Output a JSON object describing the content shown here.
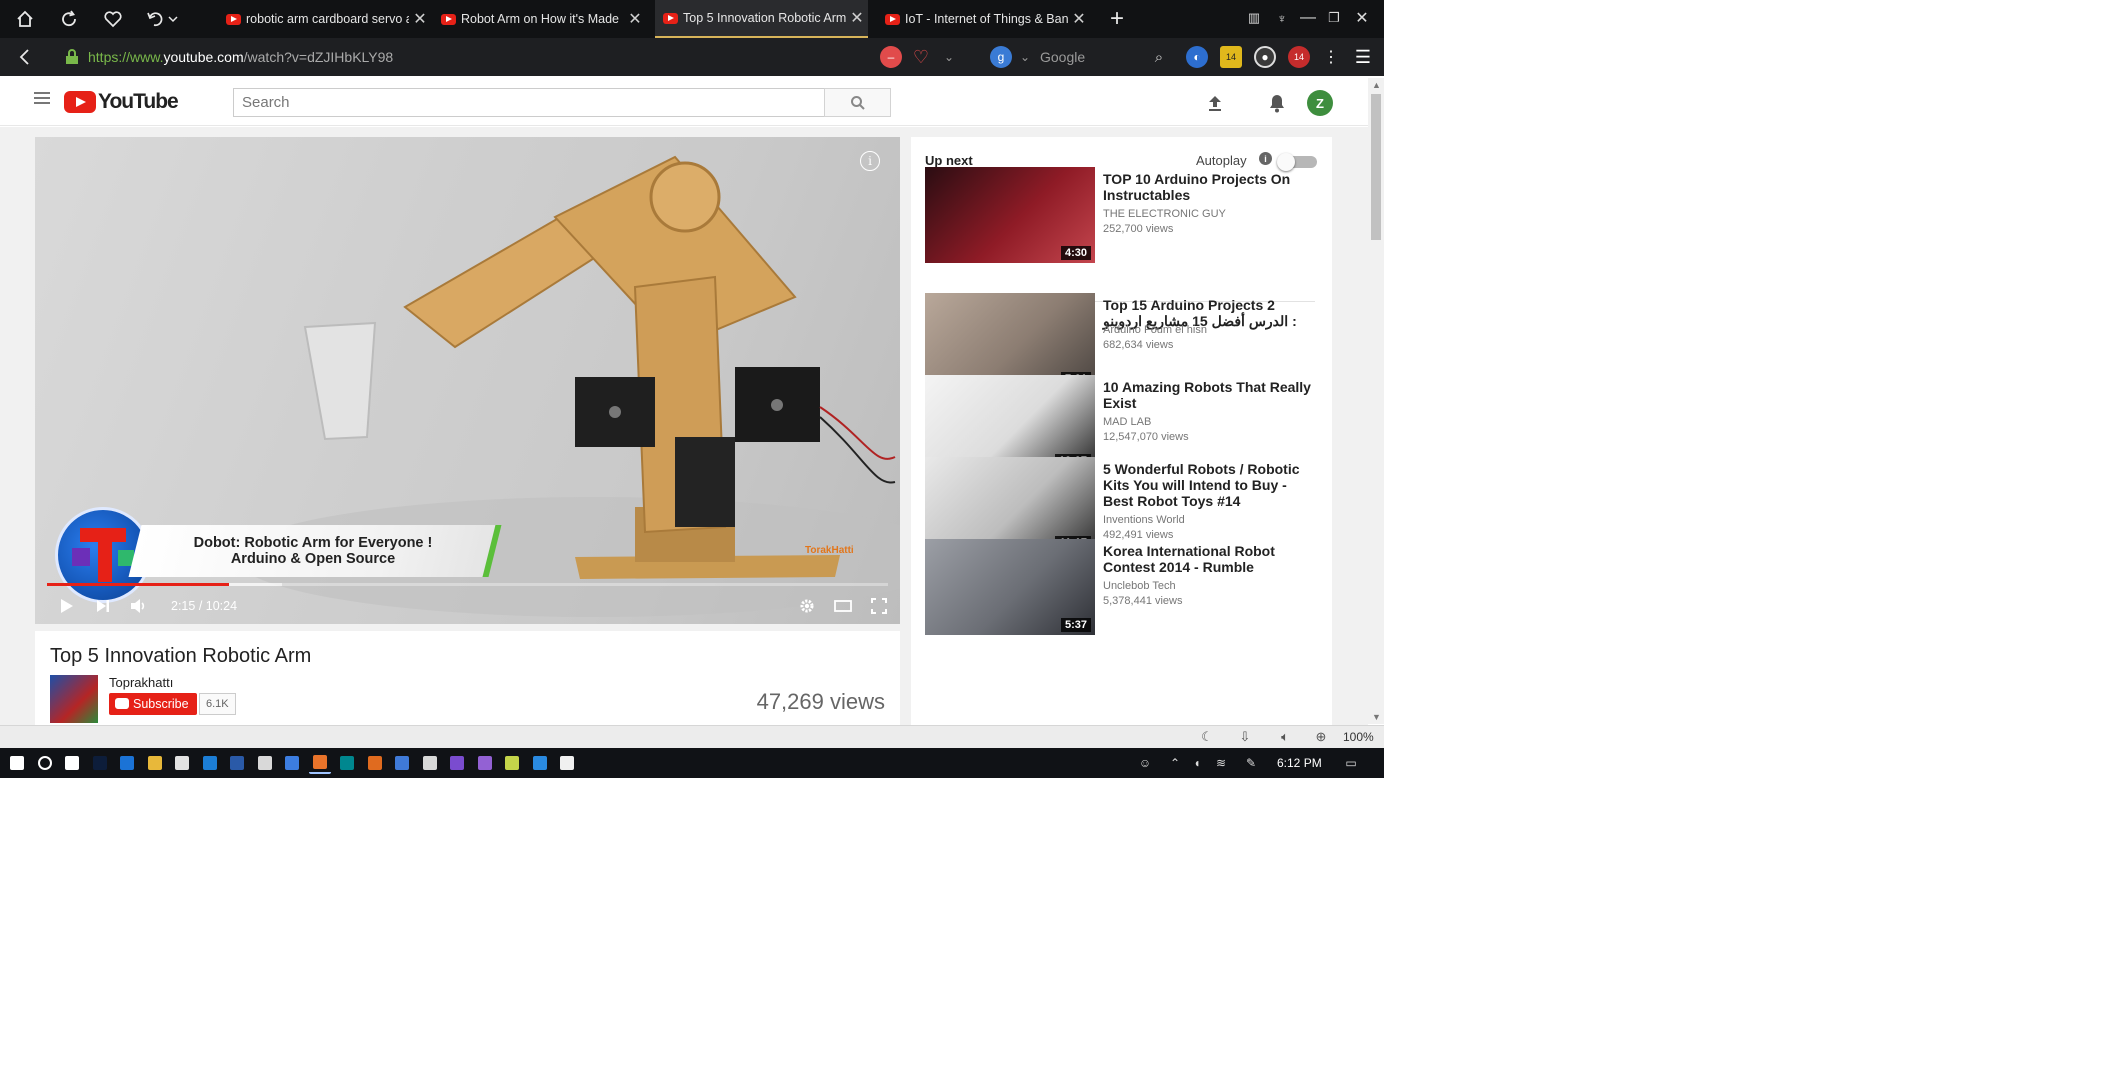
{
  "browser": {
    "tabs": [
      {
        "title": "robotic arm cardboard servo a",
        "active": false
      },
      {
        "title": "Robot Arm on How it's Made",
        "active": false
      },
      {
        "title": "Top 5 Innovation Robotic Arm",
        "active": true
      },
      {
        "title": "IoT - Internet of Things & Ban",
        "active": false
      }
    ],
    "url_scheme": "https://www.",
    "url_domain": "youtube.com",
    "url_path": "/watch?v=dZJIHbKLY98",
    "search_engine_placeholder": "Google",
    "addon_badges": {
      "badge_a": "14",
      "badge_b": "14"
    },
    "zoom_level": "100%"
  },
  "youtube": {
    "logo_text": "YouTube",
    "search_placeholder": "Search",
    "avatar_letter": "Z",
    "player": {
      "overlay_line1": "Dobot: Robotic Arm for Everyone !",
      "overlay_line2": "Arduino & Open Source",
      "watermark": "TorakHatti",
      "time_current": "2:15",
      "time_separator": " / ",
      "time_total": "10:24",
      "progress_fraction": 0.216,
      "buffer_fraction": 0.28
    },
    "video": {
      "title": "Top 5 Innovation Robotic Arm",
      "channel": "Toprakhattı",
      "subscribe_label": "Subscribe",
      "subscriber_count": "6.1K",
      "views": "47,269 views"
    },
    "sidebar": {
      "up_next_label": "Up next",
      "autoplay_label": "Autoplay",
      "autoplay_on": false,
      "items": [
        {
          "title": "TOP 10 Arduino Projects On Instructables",
          "channel": "THE ELECTRONIC GUY",
          "views": "252,700 views",
          "duration": "4:30",
          "thumb_colors": [
            "#2a0d12",
            "#8f1b26",
            "#c4464e"
          ]
        },
        {
          "title": "Top 15 Arduino Projects 2 الدرس أفضل 15 مشاريع اردوينو :",
          "channel": "Arduino Foum el hisn",
          "views": "682,634 views",
          "duration": "7:01",
          "thumb_colors": [
            "#b9a89a",
            "#8c7d72",
            "#4a4440"
          ]
        },
        {
          "title": "10 Amazing Robots That Really Exist",
          "channel": "MAD LAB",
          "views": "12,547,070 views",
          "duration": "10:07",
          "thumb_colors": [
            "#f4f4f4",
            "#dcdcdc",
            "#222222"
          ]
        },
        {
          "title": "5 Wonderful Robots / Robotic Kits You will Intend to Buy - Best Robot Toys #14",
          "channel": "Inventions World",
          "views": "492,491 views",
          "duration": "11:17",
          "thumb_colors": [
            "#e9e9e9",
            "#bdbdbd",
            "#2b2b2b"
          ]
        },
        {
          "title": "Korea International Robot Contest 2014 - Rumble",
          "channel": "Unclebob Tech",
          "views": "5,378,441 views",
          "duration": "5:37",
          "thumb_colors": [
            "#9c9fa6",
            "#6b6e75",
            "#2e3036"
          ]
        }
      ]
    }
  },
  "taskbar": {
    "clock": "6:12 PM",
    "apps": [
      "windows-start",
      "cortana",
      "task-view",
      "photoshop",
      "edge",
      "file-explorer",
      "chrome",
      "screenshot-tool",
      "powershell",
      "mail",
      "store",
      "browser",
      "arduino",
      "matlab",
      "3d-viewer",
      "app",
      "visual-studio",
      "visual-studio-alt",
      "notepad",
      "vscode",
      "sticky"
    ]
  }
}
